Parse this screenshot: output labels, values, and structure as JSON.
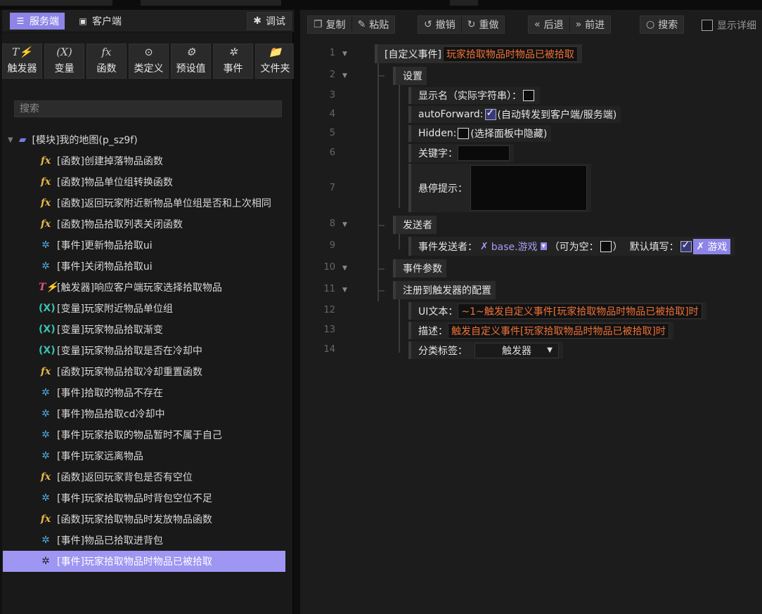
{
  "left": {
    "tabs": {
      "server": "服务端",
      "client": "客户端",
      "debug": "调试"
    },
    "tools": [
      {
        "label": "触发器",
        "icon": "trigger-icon",
        "glyph": "T⚡"
      },
      {
        "label": "变量",
        "icon": "variable-icon",
        "glyph": "(X)"
      },
      {
        "label": "函数",
        "icon": "function-icon",
        "glyph": "fx"
      },
      {
        "label": "类定义",
        "icon": "class-icon",
        "glyph": "⊙"
      },
      {
        "label": "预设值",
        "icon": "preset-icon",
        "glyph": "⚙"
      },
      {
        "label": "事件",
        "icon": "event-icon",
        "glyph": "✲"
      },
      {
        "label": "文件夹",
        "icon": "new-folder-icon",
        "glyph": "📁"
      }
    ],
    "search_placeholder": "搜索",
    "tree": {
      "root": "[模块]我的地图(p_sz9f)",
      "items": [
        {
          "kind": "fx",
          "label": "[函数]创建掉落物品函数"
        },
        {
          "kind": "fx",
          "label": "[函数]物品单位组转换函数"
        },
        {
          "kind": "fx",
          "label": "[函数]返回玩家附近新物品单位组是否和上次相同"
        },
        {
          "kind": "fx",
          "label": "[函数]物品拾取列表关闭函数"
        },
        {
          "kind": "ev",
          "label": "[事件]更新物品拾取ui"
        },
        {
          "kind": "ev",
          "label": "[事件]关闭物品拾取ui"
        },
        {
          "kind": "trg",
          "label": "[触发器]响应客户端玩家选择拾取物品"
        },
        {
          "kind": "var",
          "label": "[变量]玩家附近物品单位组"
        },
        {
          "kind": "var",
          "label": "[变量]玩家物品拾取渐变"
        },
        {
          "kind": "var",
          "label": "[变量]玩家物品拾取是否在冷却中"
        },
        {
          "kind": "fx",
          "label": "[函数]玩家物品拾取冷却重置函数"
        },
        {
          "kind": "ev",
          "label": "[事件]拾取的物品不存在"
        },
        {
          "kind": "ev",
          "label": "[事件]物品拾取cd冷却中"
        },
        {
          "kind": "ev",
          "label": "[事件]玩家拾取的物品暂时不属于自己"
        },
        {
          "kind": "ev",
          "label": "[事件]玩家远离物品"
        },
        {
          "kind": "fx",
          "label": "[函数]返回玩家背包是否有空位"
        },
        {
          "kind": "ev",
          "label": "[事件]玩家拾取物品时背包空位不足"
        },
        {
          "kind": "fx",
          "label": "[函数]玩家拾取物品时发放物品函数"
        },
        {
          "kind": "ev",
          "label": "[事件]物品已拾取进背包"
        },
        {
          "kind": "ev",
          "label": "[事件]玩家拾取物品时物品已被拾取"
        }
      ],
      "selected_index": 19
    }
  },
  "right": {
    "toolbar": {
      "copy": "复制",
      "paste": "粘贴",
      "undo": "撤销",
      "redo": "重做",
      "back": "后退",
      "forward": "前进",
      "search": "搜索",
      "show_detail": "显示详细"
    },
    "lines": [
      "1",
      "2",
      "3",
      "4",
      "5",
      "6",
      "7",
      "8",
      "9",
      "10",
      "11",
      "12",
      "13",
      "14"
    ],
    "event_label": "[自定义事件]",
    "event_name": "玩家拾取物品时物品已被拾取",
    "settings": "设置",
    "display_name_label": "显示名（实际字符串）：",
    "auto_forward_label": "autoForward:",
    "auto_forward_note": "(自动转发到客户端/服务端)",
    "hidden_label": "Hidden:",
    "hidden_note": "(选择面板中隐藏)",
    "keyword_label": "关键字：",
    "tooltip_label": "悬停提示：",
    "sender": "发送者",
    "event_sender_label": "事件发送者：",
    "event_sender_value": "base.游戏",
    "nullable_label": "（可为空：",
    "nullable_close": "）",
    "default_fill_label": "默认填写：",
    "default_fill_value": "游戏",
    "event_params": "事件参数",
    "register_config": "注册到触发器的配置",
    "ui_text_label": "UI文本：",
    "ui_text_value": "~1~触发自定义事件[玩家拾取物品时物品已被拾取]时",
    "desc_label": "描述：",
    "desc_value": "触发自定义事件[玩家拾取物品时物品已被拾取]时",
    "category_label": "分类标签：",
    "category_value": "触发器"
  }
}
